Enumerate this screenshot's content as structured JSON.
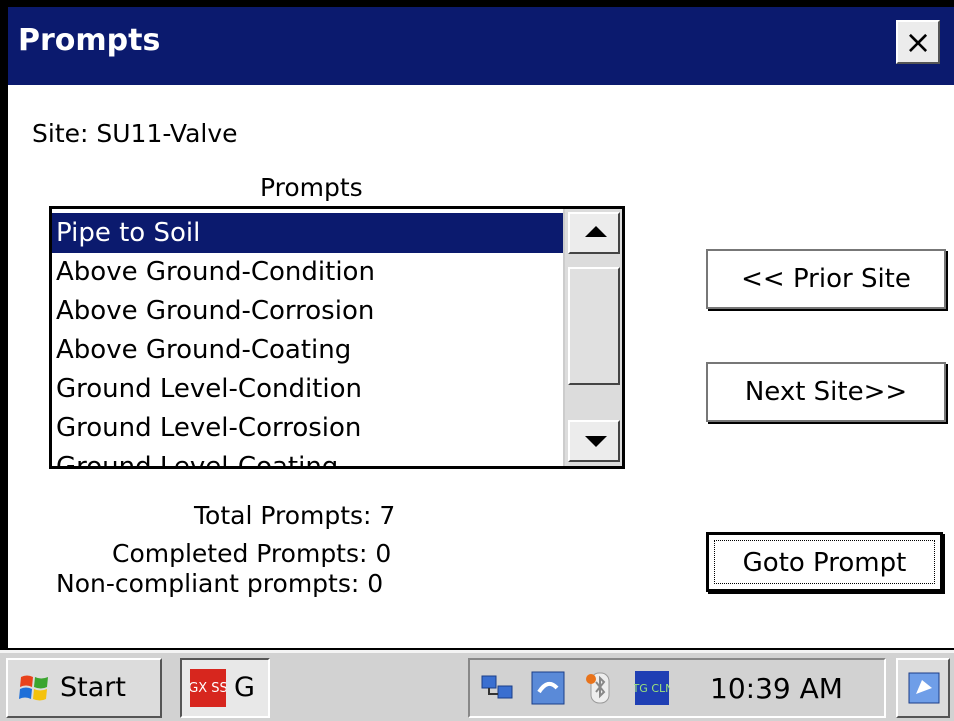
{
  "window": {
    "title": "Prompts",
    "close_glyph": "×"
  },
  "site_label": "Site: SU11-Valve",
  "list": {
    "header": "Prompts",
    "items": [
      "Pipe to Soil",
      "Above Ground-Condition",
      "Above Ground-Corrosion",
      "Above Ground-Coating",
      "Ground Level-Condition",
      "Ground Level-Corrosion",
      "Ground Level-Coating"
    ],
    "selected_index": 0
  },
  "stats": {
    "total": "Total Prompts: 7",
    "completed": "Completed Prompts: 0",
    "noncompliant": "Non-compliant prompts: 0"
  },
  "buttons": {
    "prior": "<< Prior Site",
    "next": "Next Site>>",
    "goto": "Goto Prompt"
  },
  "taskbar": {
    "start": "Start",
    "task_label": "G",
    "task_icon_text": "GX SS",
    "tray_icon_text": "OTG CLNT",
    "clock": "10:39 AM",
    "icons": [
      "windows-flag-icon",
      "gxss-app-icon",
      "network-icon",
      "sync-icon",
      "bluetooth-icon",
      "otg-client-icon",
      "desktop-icon"
    ]
  },
  "colors": {
    "titlebar": "#0b1a6e",
    "selection": "#0b1a6e",
    "taskbar": "#d2d2d2"
  }
}
